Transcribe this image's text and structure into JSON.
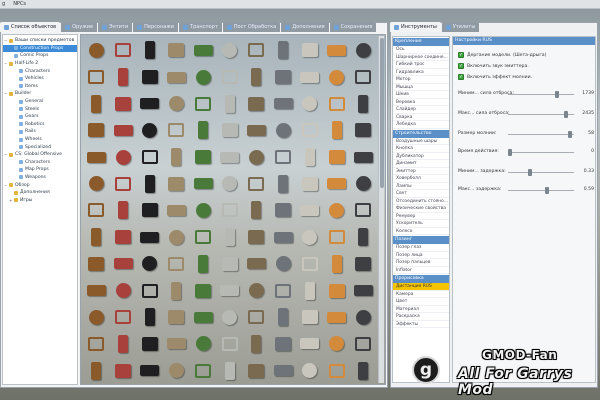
{
  "menubar": {
    "items": [
      "g",
      "NPCs"
    ]
  },
  "spawn_tabs": [
    {
      "label": "Список объектов",
      "active": true
    },
    {
      "label": "Оружие",
      "active": false
    },
    {
      "label": "Энтити",
      "active": false
    },
    {
      "label": "Персонажи",
      "active": false
    },
    {
      "label": "Транспорт",
      "active": false
    },
    {
      "label": "Пост Обработка",
      "active": false
    },
    {
      "label": "Дополнения",
      "active": false
    },
    {
      "label": "Сохранения",
      "active": false
    }
  ],
  "tree": [
    {
      "label": "Ваши списки предметов",
      "level": 0,
      "icon": "folder-icon",
      "twisty": "−",
      "selected": false
    },
    {
      "label": "Construction Props",
      "level": 1,
      "icon": "page-icon",
      "selected": true
    },
    {
      "label": "Comic Props",
      "level": 1,
      "icon": "page-icon",
      "selected": false
    },
    {
      "label": "Half-Life 2",
      "level": 0,
      "icon": "folder-icon",
      "twisty": "−",
      "selected": false
    },
    {
      "label": "Characters",
      "level": 2,
      "icon": "page-icon",
      "selected": false
    },
    {
      "label": "Vehicles",
      "level": 2,
      "icon": "page-icon",
      "selected": false
    },
    {
      "label": "Items",
      "level": 2,
      "icon": "page-icon",
      "selected": false
    },
    {
      "label": "Builder",
      "level": 0,
      "icon": "folder-icon",
      "twisty": "−",
      "selected": false
    },
    {
      "label": "General",
      "level": 2,
      "icon": "page-icon",
      "selected": false
    },
    {
      "label": "Steels",
      "level": 2,
      "icon": "page-icon",
      "selected": false
    },
    {
      "label": "Gears",
      "level": 2,
      "icon": "page-icon",
      "selected": false
    },
    {
      "label": "Robotics",
      "level": 2,
      "icon": "page-icon",
      "selected": false
    },
    {
      "label": "Rails",
      "level": 2,
      "icon": "page-icon",
      "selected": false
    },
    {
      "label": "Wheels",
      "level": 2,
      "icon": "page-icon",
      "selected": false
    },
    {
      "label": "Specialized",
      "level": 2,
      "icon": "page-icon",
      "selected": false
    },
    {
      "label": "CS: Global Offensive",
      "level": 0,
      "icon": "folder-icon",
      "twisty": "−",
      "selected": false
    },
    {
      "label": "Characters",
      "level": 2,
      "icon": "page-icon",
      "selected": false
    },
    {
      "label": "Map Props",
      "level": 2,
      "icon": "page-icon",
      "selected": false
    },
    {
      "label": "Weapons",
      "level": 2,
      "icon": "page-icon",
      "selected": false
    },
    {
      "label": "Обзор",
      "level": 0,
      "icon": "folder-icon",
      "twisty": "−",
      "selected": false
    },
    {
      "label": "Дополнения",
      "level": 1,
      "icon": "folder-icon",
      "selected": false
    },
    {
      "label": "Игры",
      "level": 1,
      "icon": "folder-icon",
      "twisty": "+",
      "selected": false
    }
  ],
  "props_palette": [
    "#8b5a2b",
    "#6d7378",
    "#4b6fa8",
    "#b7b9b4",
    "#5c3a1f",
    "#9c8a6a",
    "#3d3f42",
    "#a8403b",
    "#c9c7bd",
    "#2f5f8f",
    "#7a6a4f",
    "#e0ddd3",
    "#4a7a3a",
    "#cfb98a",
    "#1f1f22",
    "#d38a3a"
  ],
  "tool_tabs": [
    {
      "label": "Инструменты",
      "active": true
    },
    {
      "label": "Утилиты",
      "active": false
    }
  ],
  "tool_categories": [
    {
      "name": "Крепления",
      "items": [
        "Ось",
        "Шарнирное соедине...",
        "Гибкий трос",
        "Гидравлика",
        "Мотор",
        "Мышца",
        "Шкив",
        "Веревка",
        "Слайдер",
        "Сварка",
        "Лебедка"
      ]
    },
    {
      "name": "Строительство",
      "items": [
        "Воздушные шары",
        "Кнопка",
        "Дубликатор",
        "Динамит",
        "Эмиттер",
        "Ховерболл",
        "Лампы",
        "Свет",
        "Отсоединить стояно...",
        "Физические свойства",
        "Ремувер",
        "Ускоритель",
        "Колесо"
      ]
    },
    {
      "name": "Позинг",
      "items": [
        "Позер глаз",
        "Позер лица",
        "Позер пальцев",
        "Inflator"
      ]
    },
    {
      "name": "Прорисовка",
      "items": [
        "Дистанция RUS",
        "Камера",
        "Цвет",
        "Материал",
        "Раскраска",
        "Эффекты"
      ],
      "selected_index": 0
    }
  ],
  "settings": {
    "title": "Настройки RUS",
    "checkboxes": [
      {
        "label": "Дергание модели. (Шета-дрыга)",
        "checked": true
      },
      {
        "label": "Включить звук эмиттера.",
        "checked": true
      },
      {
        "label": "Включить эффект молнии.",
        "checked": true
      }
    ],
    "sliders": [
      {
        "label": "Миним... сила отброса:",
        "value": "1739",
        "fraction": 0.75
      },
      {
        "label": "Макс... сила отброса:",
        "value": "2435",
        "fraction": 0.9
      },
      {
        "label": "Размер молнии:",
        "value": "58",
        "fraction": 0.97
      },
      {
        "label": "Время действия:",
        "value": "0",
        "fraction": 0.0
      },
      {
        "label": "Миним... задержка:",
        "value": "0.33",
        "fraction": 0.33
      },
      {
        "label": "Макс... задержка:",
        "value": "0.59",
        "fraction": 0.59
      }
    ]
  },
  "watermark": {
    "logo_letter": "g",
    "brand": "GMOD-Fan",
    "subtitle": "All For Garrys Mod"
  }
}
